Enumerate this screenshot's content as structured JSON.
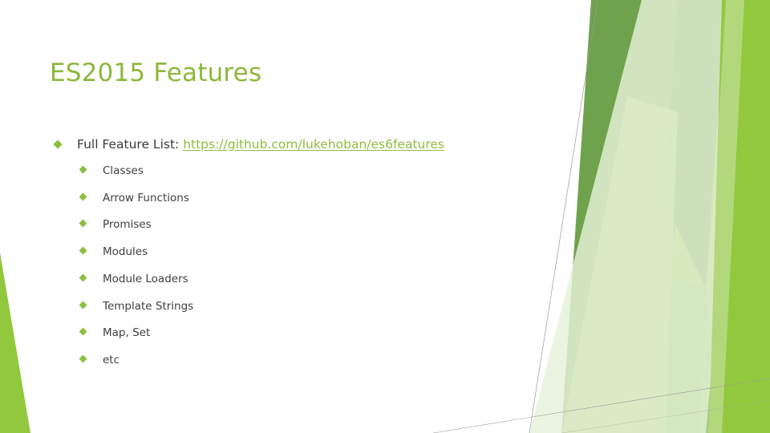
{
  "slide": {
    "title": "ES2015 Features",
    "theme_name": "facet",
    "background_color": "#FFFFFF",
    "accent_color": "#8CBF3F",
    "title_color": "#8CB83C",
    "body_text_color": "#3A3A3A",
    "link_color": "#8CBF3F",
    "bullet_glyph": "diamond"
  },
  "body": {
    "lead": {
      "label": "Full Feature List:",
      "link_text": "https://github.com/lukehoban/es6features"
    },
    "features": [
      {
        "label": "Classes"
      },
      {
        "label": "Arrow Functions"
      },
      {
        "label": "Promises"
      },
      {
        "label": "Modules"
      },
      {
        "label": "Module Loaders"
      },
      {
        "label": "Template Strings"
      },
      {
        "label": "Map, Set"
      },
      {
        "label": "etc"
      }
    ]
  },
  "decoration": {
    "palette": {
      "bright_green": "#92C83E",
      "sage_green": "#6FA24C",
      "dark_green": "#549434",
      "mid_green": "#7DBA4E",
      "pale_green": "#DCEBC8",
      "very_pale_green": "#E7F1D9",
      "line_gray": "#9A9A9A"
    }
  }
}
